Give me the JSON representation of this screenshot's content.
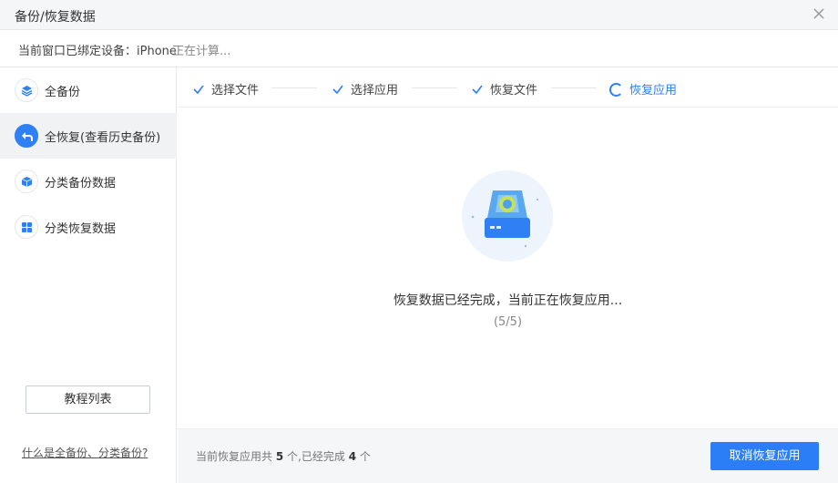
{
  "window": {
    "title": "备份/恢复数据",
    "close_icon": "close-icon"
  },
  "device_bar": {
    "bound_text": "当前窗口已绑定设备：iPhone",
    "status_text": "正在计算..."
  },
  "sidebar": {
    "items": [
      {
        "label": "全备份",
        "icon": "layers-icon",
        "active": false
      },
      {
        "label": "全恢复(查看历史备份)",
        "icon": "undo-arrow-icon",
        "active": true
      },
      {
        "label": "分类备份数据",
        "icon": "cube-icon",
        "active": false
      },
      {
        "label": "分类恢复数据",
        "icon": "grid-icon",
        "active": false
      }
    ],
    "tutorial_button": "教程列表",
    "help_link": "什么是全备份、分类备份?"
  },
  "steps": [
    {
      "label": "选择文件",
      "state": "done"
    },
    {
      "label": "选择应用",
      "state": "done"
    },
    {
      "label": "恢复文件",
      "state": "done"
    },
    {
      "label": "恢复应用",
      "state": "current"
    }
  ],
  "main": {
    "message": "恢复数据已经完成，当前正在恢复应用...",
    "progress": "(5/5)"
  },
  "footer": {
    "summary_prefix": "当前恢复应用共",
    "total": "5",
    "summary_mid": "个,已经完成",
    "done": "4",
    "summary_suffix": "个",
    "cancel_button": "取消恢复应用"
  },
  "colors": {
    "accent": "#2f7ff5",
    "active_nav_bg": "#f1f2f4"
  }
}
